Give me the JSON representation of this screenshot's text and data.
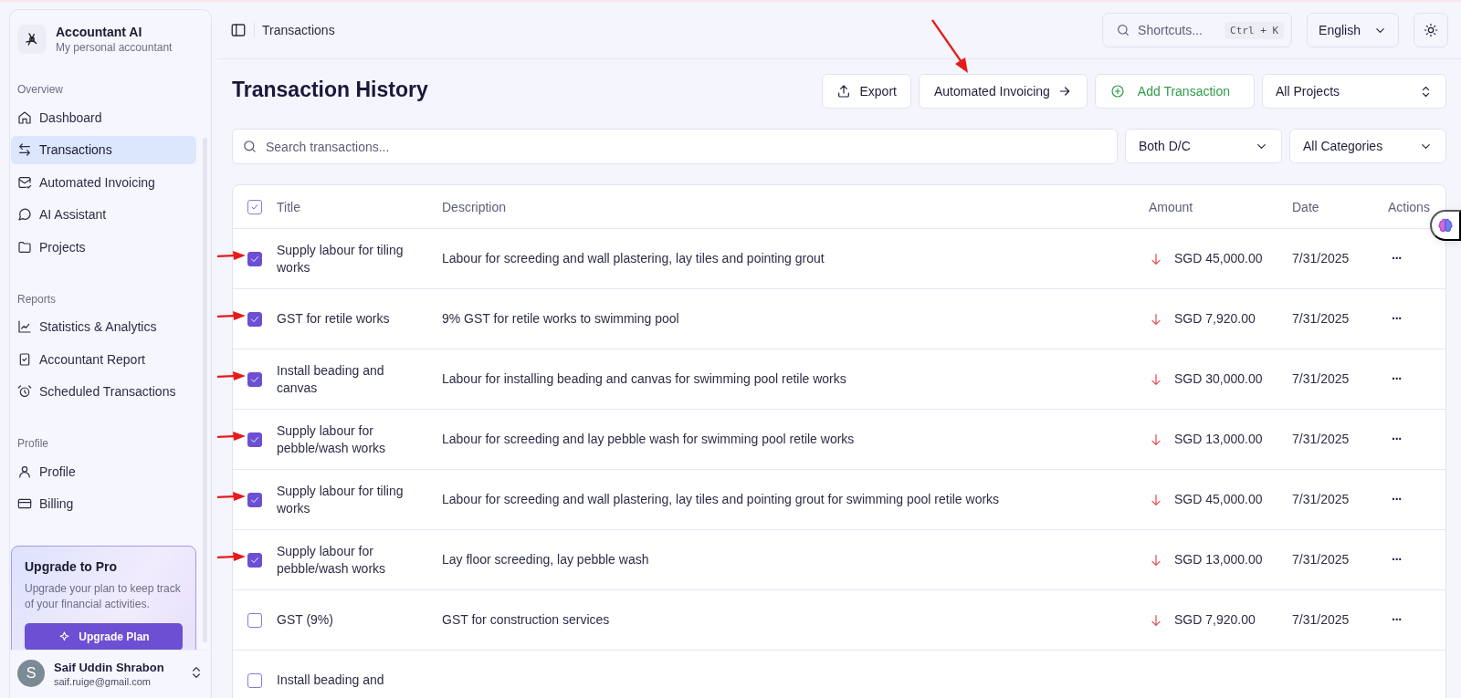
{
  "sidebar": {
    "app_name": "Accountant AI",
    "tagline": "My personal accountant",
    "sections": [
      {
        "heading": "Overview",
        "items": [
          {
            "label": "Dashboard",
            "selected": false
          },
          {
            "label": "Transactions",
            "selected": true
          },
          {
            "label": "Automated Invoicing",
            "selected": false
          },
          {
            "label": "AI Assistant",
            "selected": false
          },
          {
            "label": "Projects",
            "selected": false
          }
        ]
      },
      {
        "heading": "Reports",
        "items": [
          {
            "label": "Statistics & Analytics",
            "selected": false
          },
          {
            "label": "Accountant Report",
            "selected": false
          },
          {
            "label": "Scheduled Transactions",
            "selected": false
          }
        ]
      },
      {
        "heading": "Profile",
        "items": [
          {
            "label": "Profile",
            "selected": false
          },
          {
            "label": "Billing",
            "selected": false
          }
        ]
      }
    ],
    "upgrade": {
      "title": "Upgrade to Pro",
      "text": "Upgrade your plan to keep track of your financial activities.",
      "button": "Upgrade Plan"
    },
    "user": {
      "avatar": "S",
      "name": "Saif Uddin Shrabon",
      "email": "saif.ruige@gmail.com"
    }
  },
  "topbar": {
    "breadcrumb": "Transactions",
    "shortcuts": {
      "placeholder": "Shortcuts...",
      "key": "Ctrl + K"
    },
    "language": "English"
  },
  "page": {
    "title": "Transaction History",
    "buttons": [
      {
        "kind": "export",
        "label": "Export",
        "annotated": false
      },
      {
        "kind": "link",
        "label": "Automated Invoicing",
        "annotated": true
      },
      {
        "kind": "add",
        "label": "Add Transaction",
        "annotated": false
      }
    ],
    "project_select": "All Projects"
  },
  "filters": {
    "search_placeholder": "Search transactions...",
    "type": "Both D/C",
    "category": "All Categories"
  },
  "table": {
    "columns": [
      "Title",
      "Description",
      "Amount",
      "Date",
      "Actions"
    ],
    "all_checked": true,
    "rows": [
      {
        "title": "Supply labour for tiling works",
        "description": "Labour for screeding and wall plastering, lay tiles and pointing grout",
        "kind": "debit",
        "amount": "SGD 45,000.00",
        "date": "7/31/2025",
        "actions": "···",
        "checked": true,
        "annotated": true
      },
      {
        "title": "GST for retile works",
        "description": "9% GST for retile works to swimming pool",
        "kind": "debit",
        "amount": "SGD 7,920.00",
        "date": "7/31/2025",
        "actions": "···",
        "checked": true,
        "annotated": true
      },
      {
        "title": "Install beading and canvas",
        "description": "Labour for installing beading and canvas for swimming pool retile works",
        "kind": "debit",
        "amount": "SGD 30,000.00",
        "date": "7/31/2025",
        "actions": "···",
        "checked": true,
        "annotated": true
      },
      {
        "title": "Supply labour for pebble/wash works",
        "description": "Labour for screeding and lay pebble wash for swimming pool retile works",
        "kind": "debit",
        "amount": "SGD 13,000.00",
        "date": "7/31/2025",
        "actions": "···",
        "checked": true,
        "annotated": true
      },
      {
        "title": "Supply labour for tiling works",
        "description": "Labour for screeding and wall plastering, lay tiles and pointing grout for swimming pool retile works",
        "kind": "debit",
        "amount": "SGD 45,000.00",
        "date": "7/31/2025",
        "actions": "···",
        "checked": true,
        "annotated": true
      },
      {
        "title": "Supply labour for pebble/wash works",
        "description": "Lay floor screeding, lay pebble wash",
        "kind": "debit",
        "amount": "SGD 13,000.00",
        "date": "7/31/2025",
        "actions": "···",
        "checked": true,
        "annotated": true
      },
      {
        "title": "GST (9%)",
        "description": "GST for construction services",
        "kind": "debit",
        "amount": "SGD 7,920.00",
        "date": "7/31/2025",
        "actions": "···",
        "checked": false,
        "annotated": false
      },
      {
        "title": "Install beading and",
        "checked": false,
        "annotated": false
      }
    ]
  }
}
